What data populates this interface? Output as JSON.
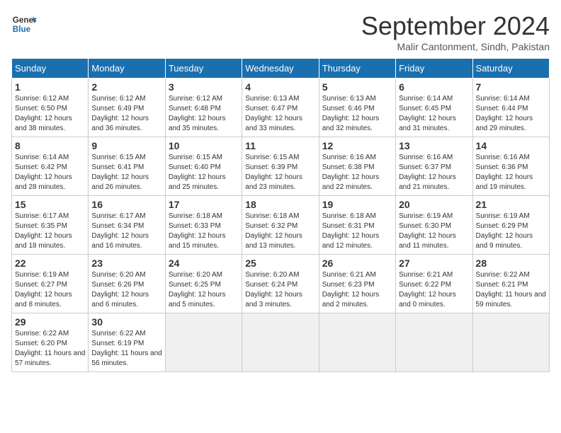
{
  "logo": {
    "line1": "General",
    "line2": "Blue"
  },
  "title": "September 2024",
  "subtitle": "Malir Cantonment, Sindh, Pakistan",
  "weekdays": [
    "Sunday",
    "Monday",
    "Tuesday",
    "Wednesday",
    "Thursday",
    "Friday",
    "Saturday"
  ],
  "weeks": [
    [
      {
        "day": "1",
        "sunrise": "6:12 AM",
        "sunset": "6:50 PM",
        "daylight": "12 hours and 38 minutes."
      },
      {
        "day": "2",
        "sunrise": "6:12 AM",
        "sunset": "6:49 PM",
        "daylight": "12 hours and 36 minutes."
      },
      {
        "day": "3",
        "sunrise": "6:12 AM",
        "sunset": "6:48 PM",
        "daylight": "12 hours and 35 minutes."
      },
      {
        "day": "4",
        "sunrise": "6:13 AM",
        "sunset": "6:47 PM",
        "daylight": "12 hours and 33 minutes."
      },
      {
        "day": "5",
        "sunrise": "6:13 AM",
        "sunset": "6:46 PM",
        "daylight": "12 hours and 32 minutes."
      },
      {
        "day": "6",
        "sunrise": "6:14 AM",
        "sunset": "6:45 PM",
        "daylight": "12 hours and 31 minutes."
      },
      {
        "day": "7",
        "sunrise": "6:14 AM",
        "sunset": "6:44 PM",
        "daylight": "12 hours and 29 minutes."
      }
    ],
    [
      {
        "day": "8",
        "sunrise": "6:14 AM",
        "sunset": "6:42 PM",
        "daylight": "12 hours and 28 minutes."
      },
      {
        "day": "9",
        "sunrise": "6:15 AM",
        "sunset": "6:41 PM",
        "daylight": "12 hours and 26 minutes."
      },
      {
        "day": "10",
        "sunrise": "6:15 AM",
        "sunset": "6:40 PM",
        "daylight": "12 hours and 25 minutes."
      },
      {
        "day": "11",
        "sunrise": "6:15 AM",
        "sunset": "6:39 PM",
        "daylight": "12 hours and 23 minutes."
      },
      {
        "day": "12",
        "sunrise": "6:16 AM",
        "sunset": "6:38 PM",
        "daylight": "12 hours and 22 minutes."
      },
      {
        "day": "13",
        "sunrise": "6:16 AM",
        "sunset": "6:37 PM",
        "daylight": "12 hours and 21 minutes."
      },
      {
        "day": "14",
        "sunrise": "6:16 AM",
        "sunset": "6:36 PM",
        "daylight": "12 hours and 19 minutes."
      }
    ],
    [
      {
        "day": "15",
        "sunrise": "6:17 AM",
        "sunset": "6:35 PM",
        "daylight": "12 hours and 18 minutes."
      },
      {
        "day": "16",
        "sunrise": "6:17 AM",
        "sunset": "6:34 PM",
        "daylight": "12 hours and 16 minutes."
      },
      {
        "day": "17",
        "sunrise": "6:18 AM",
        "sunset": "6:33 PM",
        "daylight": "12 hours and 15 minutes."
      },
      {
        "day": "18",
        "sunrise": "6:18 AM",
        "sunset": "6:32 PM",
        "daylight": "12 hours and 13 minutes."
      },
      {
        "day": "19",
        "sunrise": "6:18 AM",
        "sunset": "6:31 PM",
        "daylight": "12 hours and 12 minutes."
      },
      {
        "day": "20",
        "sunrise": "6:19 AM",
        "sunset": "6:30 PM",
        "daylight": "12 hours and 11 minutes."
      },
      {
        "day": "21",
        "sunrise": "6:19 AM",
        "sunset": "6:29 PM",
        "daylight": "12 hours and 9 minutes."
      }
    ],
    [
      {
        "day": "22",
        "sunrise": "6:19 AM",
        "sunset": "6:27 PM",
        "daylight": "12 hours and 8 minutes."
      },
      {
        "day": "23",
        "sunrise": "6:20 AM",
        "sunset": "6:26 PM",
        "daylight": "12 hours and 6 minutes."
      },
      {
        "day": "24",
        "sunrise": "6:20 AM",
        "sunset": "6:25 PM",
        "daylight": "12 hours and 5 minutes."
      },
      {
        "day": "25",
        "sunrise": "6:20 AM",
        "sunset": "6:24 PM",
        "daylight": "12 hours and 3 minutes."
      },
      {
        "day": "26",
        "sunrise": "6:21 AM",
        "sunset": "6:23 PM",
        "daylight": "12 hours and 2 minutes."
      },
      {
        "day": "27",
        "sunrise": "6:21 AM",
        "sunset": "6:22 PM",
        "daylight": "12 hours and 0 minutes."
      },
      {
        "day": "28",
        "sunrise": "6:22 AM",
        "sunset": "6:21 PM",
        "daylight": "11 hours and 59 minutes."
      }
    ],
    [
      {
        "day": "29",
        "sunrise": "6:22 AM",
        "sunset": "6:20 PM",
        "daylight": "11 hours and 57 minutes."
      },
      {
        "day": "30",
        "sunrise": "6:22 AM",
        "sunset": "6:19 PM",
        "daylight": "11 hours and 56 minutes."
      },
      null,
      null,
      null,
      null,
      null
    ]
  ]
}
